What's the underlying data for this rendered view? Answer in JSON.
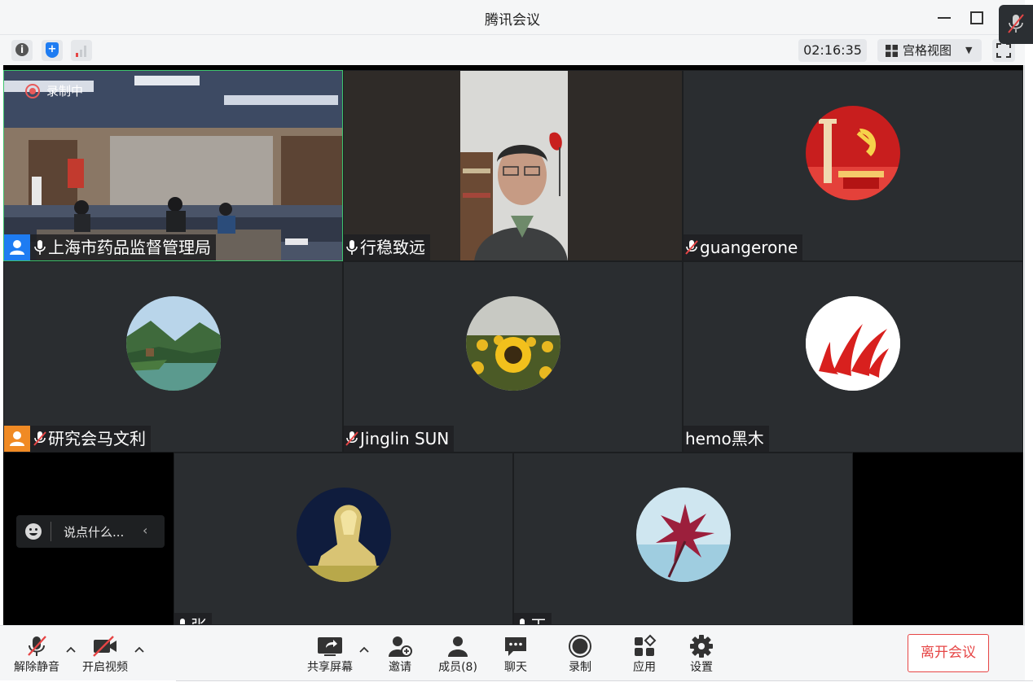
{
  "window": {
    "title": "腾讯会议"
  },
  "toolbar": {
    "timer": "02:16:35",
    "view_mode": "宫格视图"
  },
  "recording_label": "录制中",
  "participants": [
    {
      "name": "上海市药品监督管理局",
      "mic": "on",
      "host_badge": "blue",
      "type": "video-conference-room"
    },
    {
      "name": "行稳致远",
      "mic": "on",
      "type": "video-person"
    },
    {
      "name": "guangerone",
      "mic": "muted",
      "type": "avatar-party-emblem"
    },
    {
      "name": "研究会马文利",
      "mic": "muted",
      "host_badge": "orange",
      "type": "avatar-landscape"
    },
    {
      "name": "Jinglin SUN",
      "mic": "muted",
      "type": "avatar-sunflower"
    },
    {
      "name": "hemo黑木",
      "mic": "none",
      "type": "avatar-red-logo"
    },
    {
      "name": "张",
      "mic": "on",
      "type": "avatar-statue",
      "truncated": true
    },
    {
      "name": "王",
      "mic": "on",
      "type": "avatar-red-leaves",
      "truncated": true
    }
  ],
  "chat": {
    "placeholder": "说点什么..."
  },
  "bottom": {
    "unmute": "解除静音",
    "start_video": "开启视频",
    "share_screen": "共享屏幕",
    "invite": "邀请",
    "members": "成员(8)",
    "chat": "聊天",
    "record": "录制",
    "apps": "应用",
    "settings": "设置",
    "leave": "离开会议"
  },
  "colors": {
    "accent": "#1e7cf2",
    "danger": "#e64545",
    "active_border": "#3ec46d",
    "tile_bg": "#2a2d30"
  }
}
